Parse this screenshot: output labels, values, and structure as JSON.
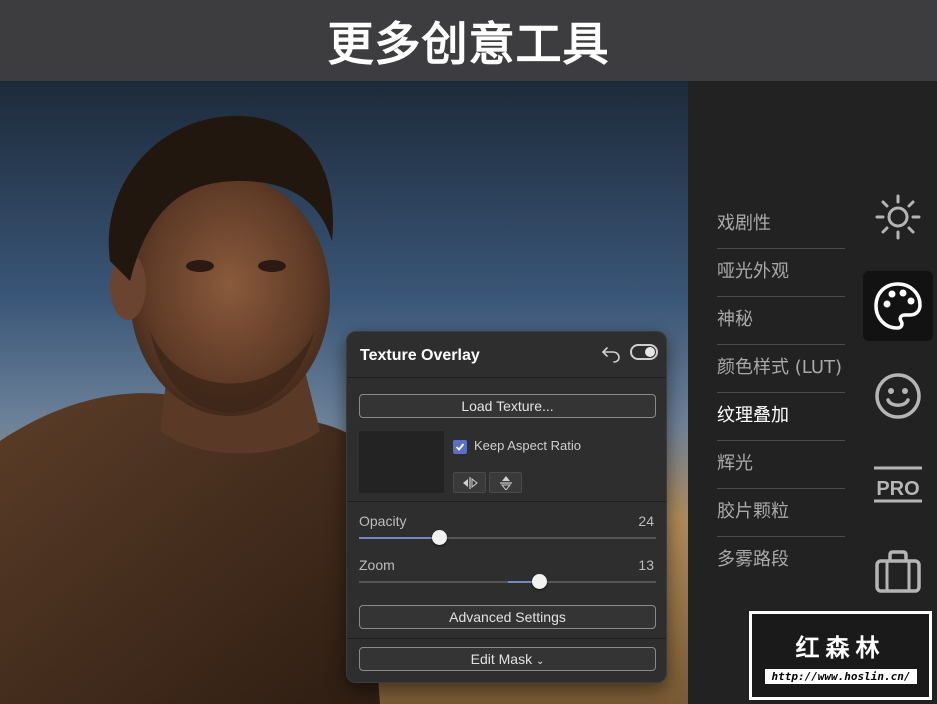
{
  "banner": {
    "title": "更多创意工具"
  },
  "panel": {
    "title": "Texture Overlay",
    "load_texture_label": "Load Texture...",
    "keep_aspect_label": "Keep Aspect Ratio",
    "keep_aspect_checked": true,
    "enabled": true,
    "opacity": {
      "label": "Opacity",
      "value": "24",
      "position": 0.27
    },
    "zoom": {
      "label": "Zoom",
      "value": "13",
      "fill_start": 0.5,
      "position": 0.605
    },
    "advanced_label": "Advanced Settings",
    "edit_mask_label": "Edit Mask",
    "edit_mask_caret": "⌄"
  },
  "sidebar": {
    "items": [
      {
        "label": "戏剧性"
      },
      {
        "label": "哑光外观"
      },
      {
        "label": "神秘"
      },
      {
        "label": "颜色样式 (LUT)"
      },
      {
        "label": "纹理叠加"
      },
      {
        "label": "辉光"
      },
      {
        "label": "胶片颗粒"
      },
      {
        "label": "多雾路段"
      }
    ],
    "active_item": "纹理叠加",
    "categories": [
      "sun-icon",
      "palette-icon",
      "face-icon",
      "pro-icon",
      "briefcase-icon"
    ],
    "selected_category": "palette-icon",
    "pro_text": "PRO"
  },
  "watermark": {
    "title": "红森林",
    "url": "http://www.hoslin.cn/"
  },
  "colors": {
    "banner_bg": "#3d3d3f",
    "sidebar_bg": "#222222",
    "panel_bg": "#2e2e2f",
    "accent": "#5a6ec4",
    "active_text": "#ffffff",
    "inactive_text": "#a9a9a9"
  }
}
